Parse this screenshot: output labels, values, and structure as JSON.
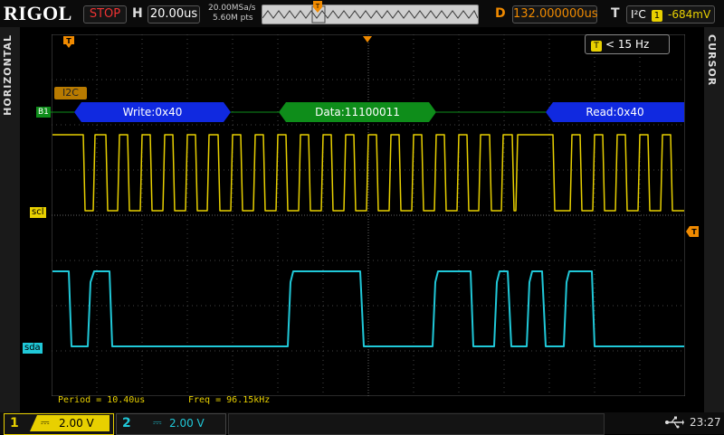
{
  "header": {
    "logo": "RIGOL",
    "run_state": "STOP",
    "timebase_label": "H",
    "timebase_value": "20.00us",
    "sample_rate": "20.00MSa/s",
    "memory_depth": "5.60M pts",
    "delay_label": "D",
    "delay_value": "132.000000us",
    "trigger_label": "T",
    "trigger_type": "I²C",
    "trigger_channel": "1",
    "trigger_level": "-684mV"
  },
  "side_panels": {
    "left": "HORIZONTAL",
    "right": "CURSOR"
  },
  "markers": {
    "trigger_pos": "T",
    "trigger_level_marker": "T",
    "bus_ch": "B1",
    "scl": "scl",
    "sda": "sda"
  },
  "filter": {
    "badge": "T",
    "text": "< 15 Hz"
  },
  "decode": {
    "tag": "I2C",
    "packets": [
      {
        "label": "Write:0x40",
        "color": "#1029e0"
      },
      {
        "label": "Data:11100011",
        "color": "#0e8d1a"
      },
      {
        "label": "Read:0x40",
        "color": "#1029e0"
      }
    ]
  },
  "measurements": {
    "period": "Period = 10.40us",
    "freq": "Freq = 96.15kHz"
  },
  "channels": [
    {
      "number": "1",
      "coupling_symbol": "⎓",
      "scale": "2.00 V",
      "color": "#e8d000"
    },
    {
      "number": "2",
      "coupling_symbol": "⎓",
      "scale": "2.00 V",
      "color": "#20c8d8"
    }
  ],
  "status": {
    "usb_icon": "usb-icon",
    "time": "23:27"
  },
  "colors": {
    "ch1": "#e8d000",
    "ch2": "#20c8d8",
    "bus_green": "#0e8d1a",
    "bus_blue": "#1029e0",
    "trigger_orange": "#f08a00",
    "stop_red": "#e33333"
  }
}
